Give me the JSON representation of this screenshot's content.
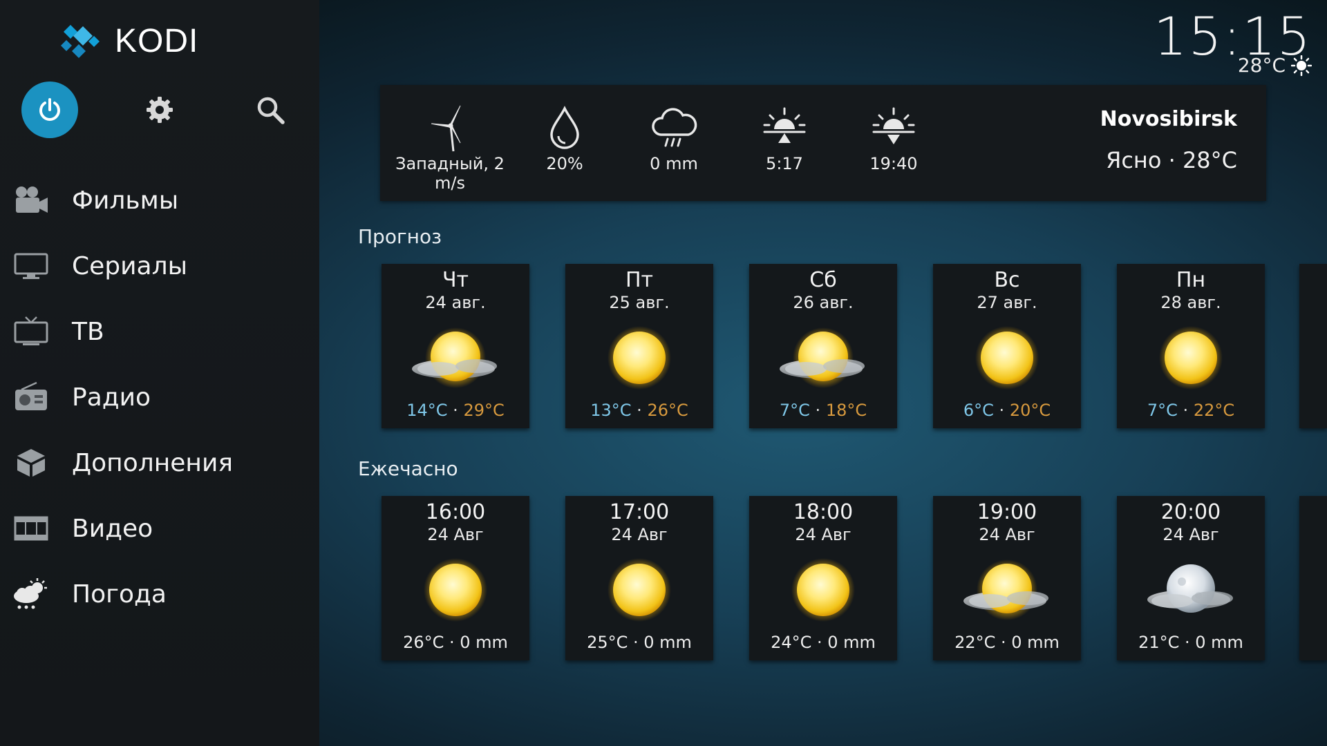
{
  "app": {
    "logo_text": "KODI"
  },
  "clock": {
    "time": "15:15",
    "temp": "28°C",
    "icon": "sun-icon"
  },
  "sidebar": {
    "top_buttons": [
      {
        "name": "power-button",
        "icon": "power-icon"
      },
      {
        "name": "settings-button",
        "icon": "gear-icon"
      },
      {
        "name": "search-button",
        "icon": "search-icon"
      }
    ],
    "items": [
      {
        "label": "Фильмы",
        "icon": "movie-camera-icon"
      },
      {
        "label": "Сериалы",
        "icon": "tv-monitor-icon"
      },
      {
        "label": "ТВ",
        "icon": "tv-antenna-icon"
      },
      {
        "label": "Радио",
        "icon": "radio-icon"
      },
      {
        "label": "Дополнения",
        "icon": "addons-box-icon"
      },
      {
        "label": "Видео",
        "icon": "film-strip-icon"
      },
      {
        "label": "Погода",
        "icon": "weather-icon"
      }
    ]
  },
  "current": {
    "wind": "Западный, 2 m/s",
    "humidity": "20%",
    "precipitation": "0 mm",
    "sunrise": "5:17",
    "sunset": "19:40",
    "city": "Novosibirsk",
    "summary": "Ясно · 28°C"
  },
  "forecast": {
    "title": "Прогноз",
    "days": [
      {
        "day": "Чт",
        "date": "24 авг.",
        "low": "14°C",
        "high": "29°C",
        "icon": "sun-cloud-icon"
      },
      {
        "day": "Пт",
        "date": "25 авг.",
        "low": "13°C",
        "high": "26°C",
        "icon": "sun-icon"
      },
      {
        "day": "Сб",
        "date": "26 авг.",
        "low": "7°C",
        "high": "18°C",
        "icon": "sun-cloud-icon"
      },
      {
        "day": "Вс",
        "date": "27 авг.",
        "low": "6°C",
        "high": "20°C",
        "icon": "sun-icon"
      },
      {
        "day": "Пн",
        "date": "28 авг.",
        "low": "7°C",
        "high": "22°C",
        "icon": "sun-icon"
      }
    ]
  },
  "hourly": {
    "title": "Ежечасно",
    "hours": [
      {
        "time": "16:00",
        "date": "24 Авг",
        "info": "26°C · 0 mm",
        "icon": "sun-icon"
      },
      {
        "time": "17:00",
        "date": "24 Авг",
        "info": "25°C · 0 mm",
        "icon": "sun-icon"
      },
      {
        "time": "18:00",
        "date": "24 Авг",
        "info": "24°C · 0 mm",
        "icon": "sun-icon"
      },
      {
        "time": "19:00",
        "date": "24 Авг",
        "info": "22°C · 0 mm",
        "icon": "sun-cloud-icon"
      },
      {
        "time": "20:00",
        "date": "24 Авг",
        "info": "21°C · 0 mm",
        "icon": "moon-cloud-icon"
      }
    ]
  },
  "colors": {
    "accent": "#1b92c1",
    "low_temp": "#7fc7e8",
    "high_temp": "#d89a3e"
  }
}
